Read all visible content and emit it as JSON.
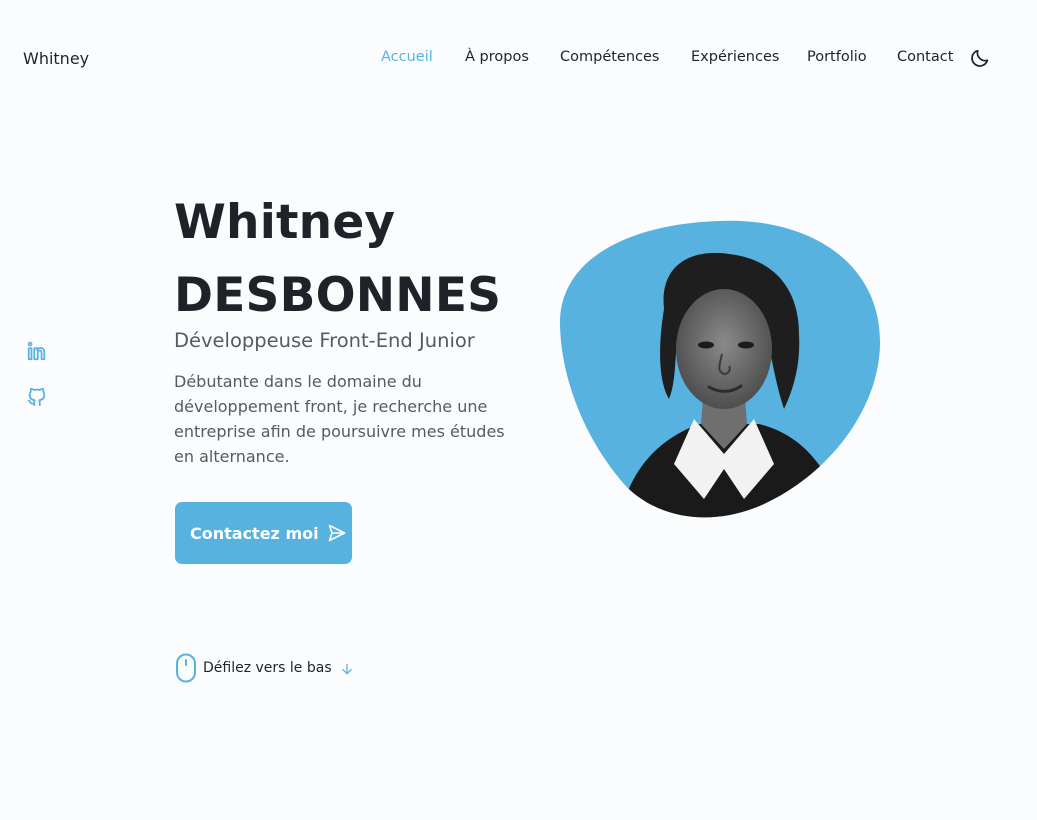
{
  "header": {
    "logo": "Whitney",
    "nav": [
      {
        "label": "Accueil",
        "active": true
      },
      {
        "label": "À propos",
        "active": false
      },
      {
        "label": "Compétences",
        "active": false
      },
      {
        "label": "Expériences",
        "active": false
      },
      {
        "label": "Portfolio",
        "active": false
      },
      {
        "label": "Contact",
        "active": false
      }
    ],
    "theme_toggle_icon": "moon-icon"
  },
  "social": [
    {
      "icon": "linkedin-icon"
    },
    {
      "icon": "github-icon"
    }
  ],
  "hero": {
    "first_name": "Whitney",
    "last_name": "DESBONNES",
    "subtitle": "Développeuse Front-End Junior",
    "description": "Débutante dans le domaine du développement front, je recherche une entreprise afin de poursuivre mes études en alternance.",
    "cta_label": "Contactez moi",
    "cta_icon": "send-icon"
  },
  "scroll": {
    "label": "Défilez vers le bas",
    "icon": "mouse-icon",
    "arrow_icon": "arrow-down-icon"
  },
  "colors": {
    "accent": "#57b2df",
    "text": "#1f2329",
    "muted": "#555b63",
    "background": "#fbfcfd"
  }
}
